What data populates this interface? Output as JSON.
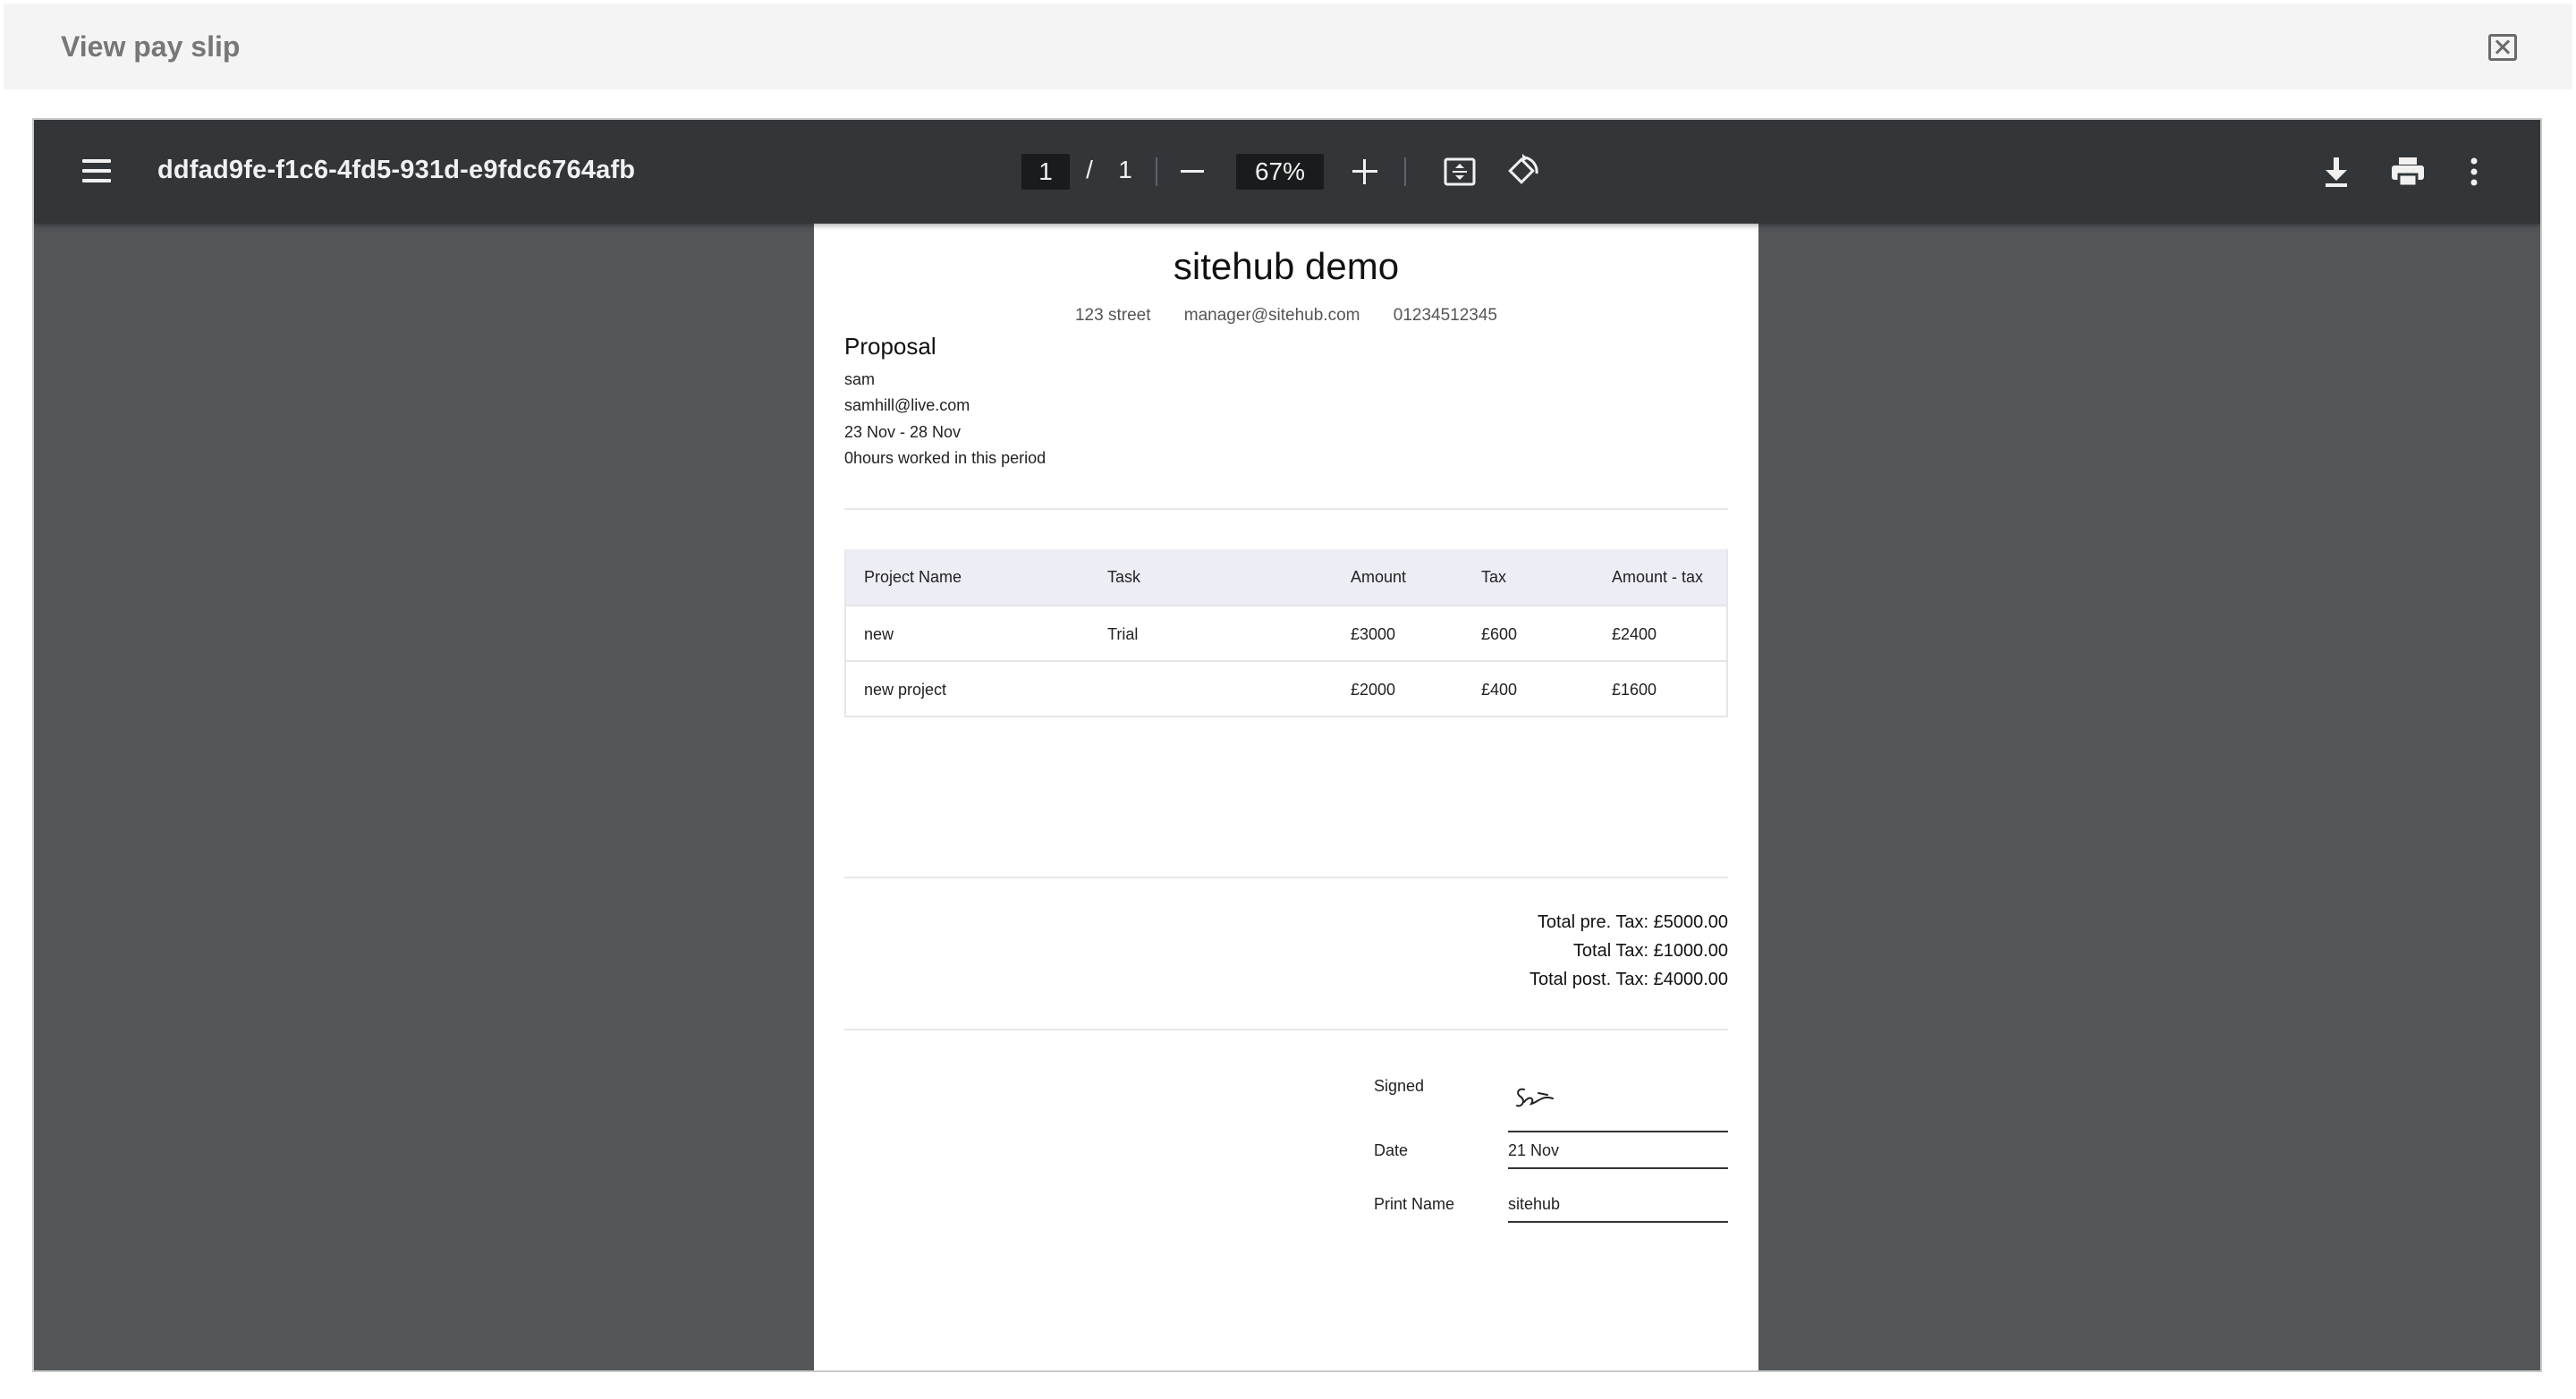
{
  "modal": {
    "title": "View pay slip"
  },
  "viewer": {
    "document_name": "ddfad9fe-f1c6-4fd5-931d-e9fdc6764afb",
    "current_page": "1",
    "page_separator": "/",
    "total_pages": "1",
    "zoom": "67%"
  },
  "payslip": {
    "company": "sitehub demo",
    "address": "123 street",
    "email": "manager@sitehub.com",
    "phone": "01234512345",
    "doc_type": "Proposal",
    "employee_name": "sam",
    "employee_email": "samhill@live.com",
    "period": "23 Nov - 28 Nov",
    "hours": "0hours worked in this period",
    "table": {
      "headers": [
        "Project Name",
        "Task",
        "Amount",
        "Tax",
        "Amount - tax"
      ],
      "rows": [
        [
          "new",
          "Trial",
          "£3000",
          "£600",
          "£2400"
        ],
        [
          "new project",
          "",
          "£2000",
          "£400",
          "£1600"
        ]
      ]
    },
    "totals": {
      "pre_tax": "Total pre. Tax: £5000.00",
      "tax": "Total Tax: £1000.00",
      "post_tax": "Total post. Tax: £4000.00"
    },
    "signature": {
      "signed_label": "Signed",
      "date_label": "Date",
      "date_value": "21 Nov",
      "print_name_label": "Print Name",
      "print_name_value": "sitehub"
    }
  }
}
